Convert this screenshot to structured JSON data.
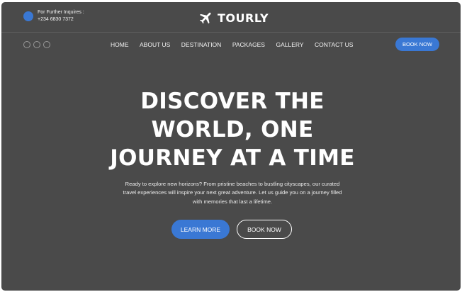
{
  "colors": {
    "background": "#4a4a4a",
    "accent": "#3a78d4",
    "text": "#ffffff"
  },
  "topbar": {
    "inquiry_label": "For Further Inquires :",
    "inquiry_phone": "+234 6830 7372",
    "brand_icon": "airplane-icon",
    "brand_name": "TOURLY"
  },
  "nav": {
    "items": [
      "HOME",
      "ABOUT US",
      "DESTINATION",
      "PACKAGES",
      "GALLERY",
      "CONTACT US"
    ],
    "cta": "BOOK NOW"
  },
  "hero": {
    "title_lines": [
      "DISCOVER THE",
      "WORLD, ONE",
      "JOURNEY AT A TIME"
    ],
    "subtitle_lines": [
      "Ready to explore new horizons? From pristine beaches to bustling cityscapes, our curated",
      "travel experiences will inspire your next great adventure. Let us guide you on a journey filled",
      "with memories that last a lifetime."
    ],
    "primary_button": "LEARN MORE",
    "secondary_button": "BOOK NOW"
  }
}
